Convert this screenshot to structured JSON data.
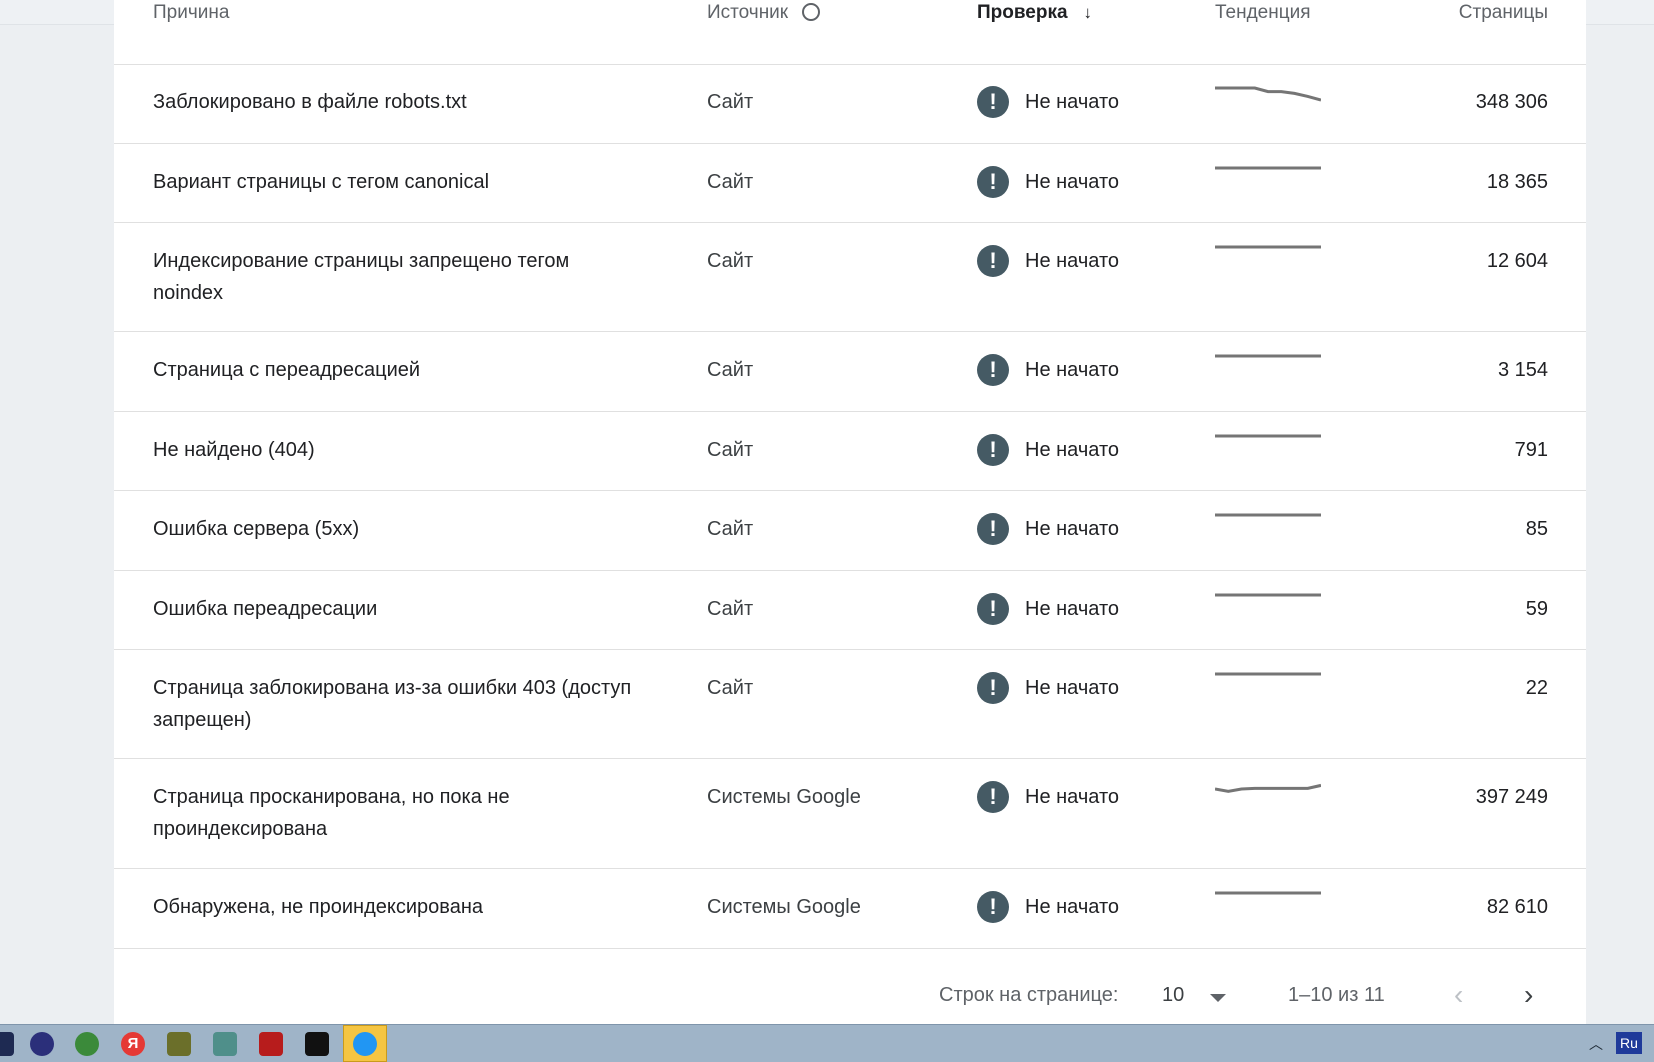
{
  "table": {
    "headers": {
      "reason": "Причина",
      "source": "Источник",
      "check": "Проверка",
      "trend": "Тенденция",
      "pages": "Страницы"
    },
    "rows": [
      {
        "reason": "Заблокировано в файле robots.txt",
        "source": "Сайт",
        "status": "Не начато",
        "trend_points": [
          0,
          0,
          0,
          0,
          0.3,
          0.3,
          0.45,
          0.7,
          1
        ],
        "pages": "348 306"
      },
      {
        "reason": "Вариант страницы с тегом canonical",
        "source": "Сайт",
        "status": "Не начато",
        "trend_points": [
          0,
          0,
          0,
          0,
          0,
          0,
          0,
          0,
          0
        ],
        "pages": "18 365"
      },
      {
        "reason": "Индексирование страницы запрещено тегом noindex",
        "source": "Сайт",
        "status": "Не начато",
        "trend_points": [
          0,
          0,
          0,
          0,
          0,
          0,
          0,
          0,
          0
        ],
        "pages": "12 604"
      },
      {
        "reason": "Страница с переадресацией",
        "source": "Сайт",
        "status": "Не начато",
        "trend_points": [
          0,
          0,
          0,
          0,
          0,
          0,
          0,
          0,
          0
        ],
        "pages": "3 154"
      },
      {
        "reason": "Не найдено (404)",
        "source": "Сайт",
        "status": "Не начато",
        "trend_points": [
          0,
          0,
          0,
          0,
          0,
          0,
          0,
          0,
          0
        ],
        "pages": "791"
      },
      {
        "reason": "Ошибка сервера (5xx)",
        "source": "Сайт",
        "status": "Не начато",
        "trend_points": [
          0,
          0,
          0,
          0,
          0,
          0,
          0,
          0,
          0
        ],
        "pages": "85"
      },
      {
        "reason": "Ошибка переадресации",
        "source": "Сайт",
        "status": "Не начато",
        "trend_points": [
          0,
          0,
          0,
          0,
          0,
          0,
          0,
          0,
          0
        ],
        "pages": "59"
      },
      {
        "reason": "Страница заблокирована из-за ошибки 403 (доступ запрещен)",
        "source": "Сайт",
        "status": "Не начато",
        "trend_points": [
          0,
          0,
          0,
          0,
          0,
          0,
          0,
          0,
          0
        ],
        "pages": "22"
      },
      {
        "reason": "Страница просканирована, но пока не проиндексирована",
        "source": "Системы Google",
        "status": "Не начато",
        "trend_points": [
          0.5,
          0.7,
          0.5,
          0.45,
          0.45,
          0.45,
          0.45,
          0.45,
          0.2
        ],
        "pages": "397 249"
      },
      {
        "reason": "Обнаружена, не проиндексирована",
        "source": "Системы Google",
        "status": "Не начато",
        "trend_points": [
          0,
          0,
          0,
          0,
          0,
          0,
          0,
          0,
          0
        ],
        "pages": "82 610"
      }
    ]
  },
  "pagination": {
    "rows_per_page_label": "Строк на странице:",
    "rows_per_page_value": "10",
    "range_label": "1–10 из 11",
    "prev_icon": "chevron-left-icon",
    "next_icon": "chevron-right-icon"
  },
  "taskbar": {
    "language": "Ru"
  },
  "colors": {
    "warning_icon_bg": "#455a64",
    "sparkline": "#757575",
    "taskbar": "#9fb4c8",
    "active_task": "#f5c542"
  }
}
